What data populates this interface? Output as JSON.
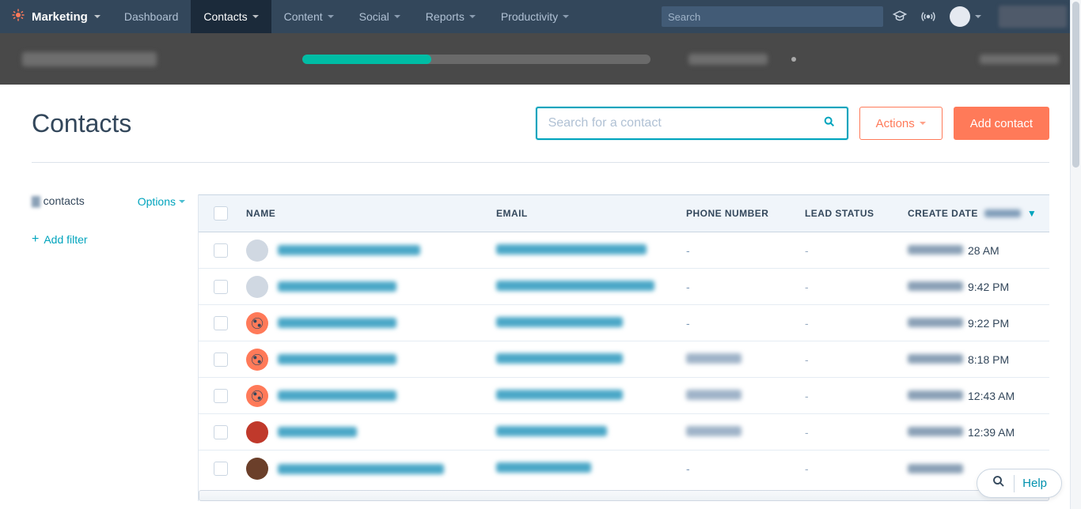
{
  "nav": {
    "brand": "Marketing",
    "items": [
      {
        "label": "Dashboard",
        "active": false,
        "hasCaret": false
      },
      {
        "label": "Contacts",
        "active": true,
        "hasCaret": true
      },
      {
        "label": "Content",
        "active": false,
        "hasCaret": true
      },
      {
        "label": "Social",
        "active": false,
        "hasCaret": true
      },
      {
        "label": "Reports",
        "active": false,
        "hasCaret": true
      },
      {
        "label": "Productivity",
        "active": false,
        "hasCaret": true
      }
    ],
    "search_placeholder": "Search"
  },
  "progress": {
    "fill_pct": 37
  },
  "page": {
    "title": "Contacts",
    "search_placeholder": "Search for a contact",
    "actions_label": "Actions",
    "add_label": "Add contact"
  },
  "sidebar": {
    "contacts_label": "contacts",
    "options_label": "Options",
    "add_filter_label": "Add filter"
  },
  "table": {
    "columns": {
      "name": "NAME",
      "email": "EMAIL",
      "phone": "PHONE NUMBER",
      "lead": "LEAD STATUS",
      "date": "CREATE DATE"
    },
    "rows": [
      {
        "avatar": "grey",
        "nameW": 180,
        "emailW": 190,
        "phone": "-",
        "lead": "-",
        "time": "28 AM"
      },
      {
        "avatar": "grey",
        "nameW": 150,
        "emailW": 200,
        "phone": "-",
        "lead": "-",
        "time": "9:42 PM"
      },
      {
        "avatar": "o",
        "nameW": 150,
        "emailW": 160,
        "phone": "-",
        "lead": "-",
        "time": "9:22 PM"
      },
      {
        "avatar": "o",
        "nameW": 150,
        "emailW": 160,
        "phone": "···",
        "lead": "-",
        "time": "8:18 PM"
      },
      {
        "avatar": "o",
        "nameW": 150,
        "emailW": 160,
        "phone": "···",
        "lead": "-",
        "time": "12:43 AM"
      },
      {
        "avatar": "red",
        "nameW": 100,
        "emailW": 140,
        "phone": "···",
        "lead": "-",
        "time": "12:39 AM"
      },
      {
        "avatar": "photo",
        "nameW": 210,
        "emailW": 120,
        "phone": "-",
        "lead": "-",
        "time": ""
      }
    ]
  },
  "help": {
    "label": "Help"
  }
}
